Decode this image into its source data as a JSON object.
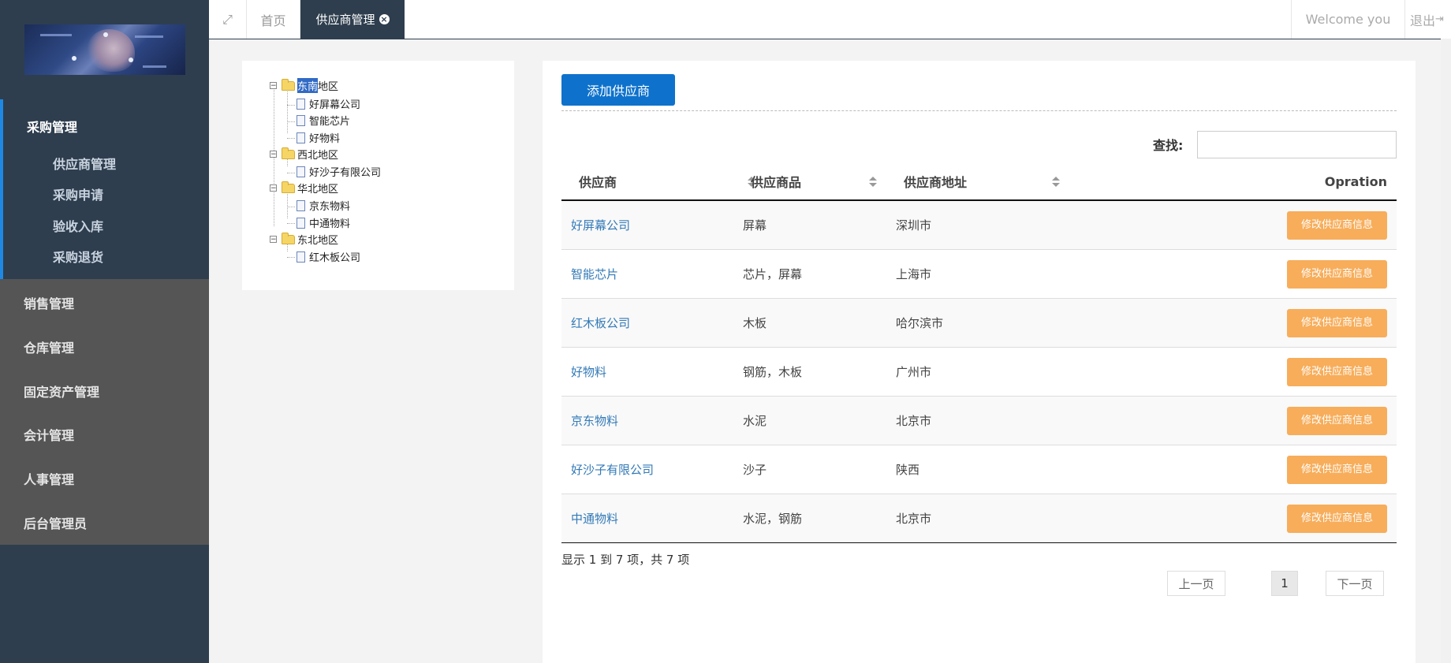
{
  "sidebar": {
    "active_group": "采购管理",
    "sub_items": [
      "供应商管理",
      "采购申请",
      "验收入库",
      "采购退货"
    ],
    "menu_items": [
      "销售管理",
      "仓库管理",
      "固定资产管理",
      "会计管理",
      "人事管理",
      "后台管理员"
    ]
  },
  "topbar": {
    "expand_icon": "expand-arrows-icon",
    "home_tab": "首页",
    "active_tab": "供应商管理",
    "welcome": "Welcome you",
    "logout": "退出"
  },
  "tree": {
    "regions": [
      {
        "name_hl": "东南",
        "name_rest": "地区",
        "children": [
          "好屏幕公司",
          "智能芯片",
          "好物料"
        ]
      },
      {
        "name": "西北地区",
        "children": [
          "好沙子有限公司"
        ]
      },
      {
        "name": "华北地区",
        "children": [
          "京东物料",
          "中通物料"
        ]
      },
      {
        "name": "东北地区",
        "children": [
          "红木板公司"
        ]
      }
    ]
  },
  "main": {
    "add_button": "添加供应商",
    "search_label": "查找:",
    "search_value": "",
    "columns": [
      "供应商",
      "供应商品",
      "供应商地址",
      "Opration"
    ],
    "rows": [
      {
        "name": "好屏幕公司",
        "goods": "屏幕",
        "address": "深圳市",
        "action": "修改供应商信息"
      },
      {
        "name": "智能芯片",
        "goods": "芯片，屏幕",
        "address": "上海市",
        "action": "修改供应商信息"
      },
      {
        "name": "红木板公司",
        "goods": "木板",
        "address": "哈尔滨市",
        "action": "修改供应商信息"
      },
      {
        "name": "好物料",
        "goods": "钢筋，木板",
        "address": "广州市",
        "action": "修改供应商信息"
      },
      {
        "name": "京东物料",
        "goods": "水泥",
        "address": "北京市",
        "action": "修改供应商信息"
      },
      {
        "name": "好沙子有限公司",
        "goods": "沙子",
        "address": "陕西",
        "action": "修改供应商信息"
      },
      {
        "name": "中通物料",
        "goods": "水泥，钢筋",
        "address": "北京市",
        "action": "修改供应商信息"
      }
    ],
    "info": "显示 1 到 7 项，共 7 项",
    "pagination": {
      "prev": "上一页",
      "current": "1",
      "next": "下一页"
    }
  }
}
